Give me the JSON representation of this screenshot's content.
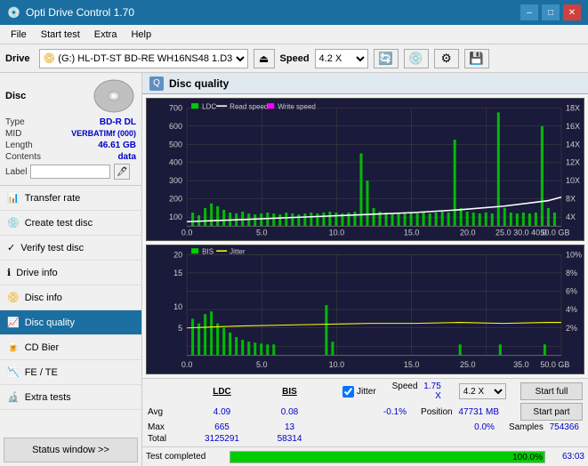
{
  "app": {
    "title": "Opti Drive Control 1.70",
    "icon": "disc-icon"
  },
  "titlebar": {
    "title": "Opti Drive Control 1.70",
    "minimize_label": "–",
    "maximize_label": "□",
    "close_label": "✕"
  },
  "menubar": {
    "items": [
      "File",
      "Start test",
      "Extra",
      "Help"
    ]
  },
  "toolbar": {
    "drive_label": "Drive",
    "drive_value": "(G:)  HL-DT-ST BD-RE  WH16NS48 1.D3",
    "speed_label": "Speed",
    "speed_value": "4.2 X"
  },
  "disc": {
    "type_label": "Type",
    "type_value": "BD-R DL",
    "mid_label": "MID",
    "mid_value": "VERBATIMf (000)",
    "length_label": "Length",
    "length_value": "46.61 GB",
    "contents_label": "Contents",
    "contents_value": "data",
    "label_label": "Label",
    "label_value": ""
  },
  "nav": {
    "items": [
      {
        "id": "transfer-rate",
        "label": "Transfer rate",
        "active": false
      },
      {
        "id": "create-test-disc",
        "label": "Create test disc",
        "active": false
      },
      {
        "id": "verify-test-disc",
        "label": "Verify test disc",
        "active": false
      },
      {
        "id": "drive-info",
        "label": "Drive info",
        "active": false
      },
      {
        "id": "disc-info",
        "label": "Disc info",
        "active": false
      },
      {
        "id": "disc-quality",
        "label": "Disc quality",
        "active": true
      },
      {
        "id": "cd-bier",
        "label": "CD Bier",
        "active": false
      },
      {
        "id": "fe-te",
        "label": "FE / TE",
        "active": false
      },
      {
        "id": "extra-tests",
        "label": "Extra tests",
        "active": false
      }
    ],
    "status_window_btn": "Status window >>"
  },
  "quality": {
    "title": "Disc quality",
    "legend": {
      "ldc": "LDC",
      "read_speed": "Read speed",
      "write_speed": "Write speed"
    },
    "legend2": {
      "bis": "BIS",
      "jitter": "Jitter"
    }
  },
  "stats": {
    "headers": [
      "",
      "LDC",
      "BIS",
      "",
      "Jitter",
      "Speed",
      "",
      ""
    ],
    "avg_label": "Avg",
    "avg_ldc": "4.09",
    "avg_bis": "0.08",
    "avg_jitter": "-0.1%",
    "max_label": "Max",
    "max_ldc": "665",
    "max_bis": "13",
    "max_jitter": "0.0%",
    "total_label": "Total",
    "total_ldc": "3125291",
    "total_bis": "58314",
    "jitter_checked": true,
    "jitter_label": "Jitter",
    "speed_label": "Speed",
    "speed_value": "1.75 X",
    "speed_select": "4.2 X",
    "position_label": "Position",
    "position_value": "47731 MB",
    "samples_label": "Samples",
    "samples_value": "754366",
    "start_full_label": "Start full",
    "start_part_label": "Start part"
  },
  "progress": {
    "status_text": "Test completed",
    "percent": 100.0,
    "percent_display": "100.0%",
    "number": "63:03"
  }
}
